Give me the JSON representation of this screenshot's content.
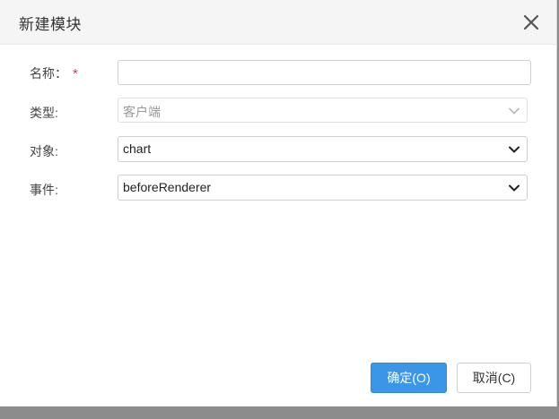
{
  "dialog": {
    "title": "新建模块",
    "close_icon": "close-icon"
  },
  "form": {
    "name": {
      "label": "名称：",
      "required_mark": "*",
      "value": "",
      "placeholder": ""
    },
    "type": {
      "label": "类型:",
      "value": "客户端",
      "disabled": true,
      "icon": "chevron-down-icon"
    },
    "object": {
      "label": "对象:",
      "value": "chart",
      "icon": "chevron-down-icon"
    },
    "event": {
      "label": "事件:",
      "value": "beforeRenderer",
      "icon": "chevron-down-icon"
    }
  },
  "buttons": {
    "confirm_label": "确定(O)",
    "cancel_label": "取消(C)"
  },
  "colors": {
    "primary": "#3b96e8",
    "required": "#e23b3b"
  }
}
